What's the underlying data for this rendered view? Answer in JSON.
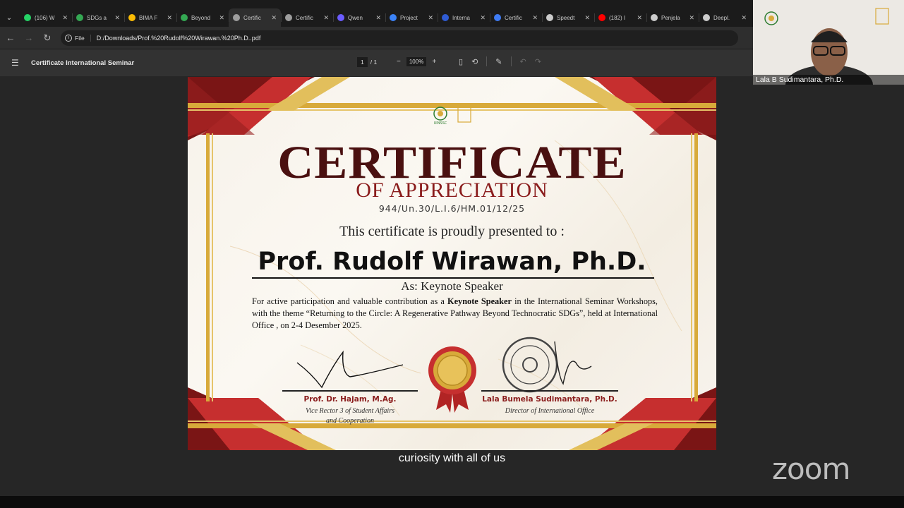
{
  "browser": {
    "tabs": [
      {
        "label": "(106) W",
        "color": "#25d366"
      },
      {
        "label": "SDGs a",
        "color": "#34a853"
      },
      {
        "label": "BIMA F",
        "color": "#fbbc04"
      },
      {
        "label": "Beyond",
        "color": "#34a853"
      },
      {
        "label": "Certific",
        "color": "#9e9e9e",
        "active": true
      },
      {
        "label": "Certific",
        "color": "#9e9e9e"
      },
      {
        "label": "Qwen",
        "color": "#6b5cff"
      },
      {
        "label": "Project",
        "color": "#3b82f6"
      },
      {
        "label": "Interna",
        "color": "#2f5bd3"
      },
      {
        "label": "Certific",
        "color": "#3f7cf4"
      },
      {
        "label": "Speedt",
        "color": "#cccccc"
      },
      {
        "label": "(182) I",
        "color": "#ff0000"
      },
      {
        "label": "Penjela",
        "color": "#cccccc"
      },
      {
        "label": "Deepl.",
        "color": "#cccccc"
      }
    ],
    "address": {
      "chip": "File",
      "url": "D:/Downloads/Prof.%20Rudolf%20Wirawan.%20Ph.D..pdf"
    }
  },
  "pdf": {
    "title": "Certificate International Seminar",
    "page_current": "1",
    "page_total": "1",
    "zoom": "100%"
  },
  "certificate": {
    "title": "CERTIFICATE",
    "subtitle": "OF APPRECIATION",
    "number": "944/Un.30/L.I.6/HM.01/12/25",
    "presented": "This certificate is proudly presented to :",
    "name": "Prof. Rudolf Wirawan, Ph.D.",
    "role": "As: Keynote Speaker",
    "body_pre": "For active participation and valuable contribution as a ",
    "body_bold": "Keynote Speaker",
    "body_post": " in the International Seminar Workshops, with the theme “Returning to the Circle: A Regenerative Pathway Beyond Technocratic SDGs”, held at International Office , on 2-4 Desember 2025.",
    "logo_text": "UINSSC",
    "signer1": {
      "name": "Prof. Dr. Hajam, M.Ag.",
      "role_line1": "Vice Rector 3 of Student Affairs",
      "role_line2": "and Cooperation"
    },
    "signer2": {
      "name": "Lala Bumela Sudimantara, Ph.D.",
      "role": "Director of International Office"
    },
    "stamp_text": "KEMENTERIAN AGAMA"
  },
  "zoom": {
    "caption": "curiosity with all of us",
    "participant": "Lala B Sudimantara, Ph.D.",
    "logo": "zoom"
  },
  "colors": {
    "cert_red": "#8a1c1c",
    "cert_dark": "#4a1010",
    "gold": "#d8aa3a"
  }
}
